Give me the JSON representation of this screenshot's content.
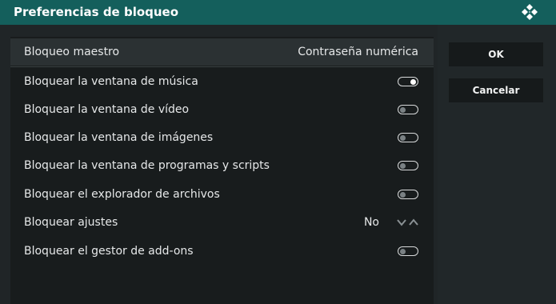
{
  "dialog": {
    "title": "Preferencias de bloqueo",
    "logo_icon": "kodi-logo-icon"
  },
  "settings": [
    {
      "label": "Bloqueo maestro",
      "type": "value",
      "value": "Contraseña numérica",
      "focused": true
    },
    {
      "label": "Bloquear la ventana de música",
      "type": "toggle",
      "enabled": true
    },
    {
      "label": "Bloquear la ventana de vídeo",
      "type": "toggle",
      "enabled": false
    },
    {
      "label": "Bloquear la ventana de imágenes",
      "type": "toggle",
      "enabled": false
    },
    {
      "label": "Bloquear la ventana de programas y scripts",
      "type": "toggle",
      "enabled": false
    },
    {
      "label": "Bloquear el explorador de archivos",
      "type": "toggle",
      "enabled": false
    },
    {
      "label": "Bloquear ajustes",
      "type": "spinner",
      "value": "No"
    },
    {
      "label": "Bloquear el gestor de add-ons",
      "type": "toggle",
      "enabled": false
    }
  ],
  "buttons": {
    "ok_label": "OK",
    "cancel_label": "Cancelar"
  },
  "colors": {
    "title_bar": "#145f5c",
    "dialog_bg": "#202527",
    "list_bg": "#181c1d",
    "focus_row": "#2b3133",
    "button_bg": "#161a1b"
  }
}
